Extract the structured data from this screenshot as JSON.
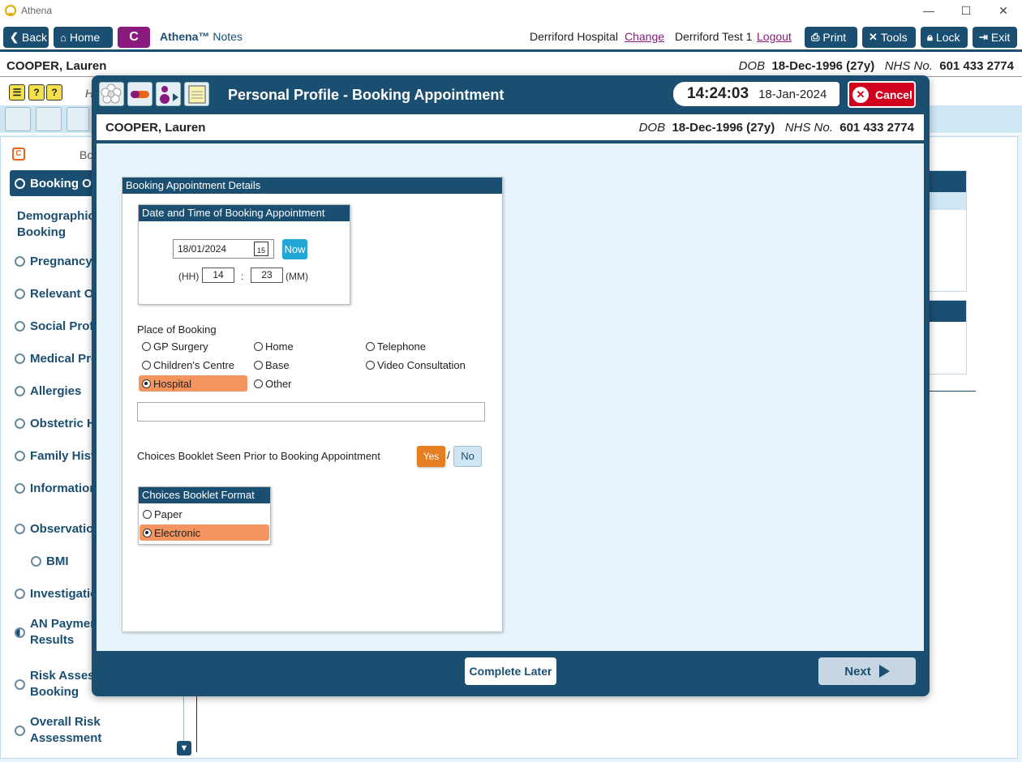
{
  "window": {
    "title": "Athena",
    "min": "—",
    "max": "☐",
    "close": "✕"
  },
  "toolbar": {
    "back": "Back",
    "home": "Home",
    "c_button": "C",
    "brand": "Athena™",
    "brand_sub": "Notes",
    "hospital": "Derriford Hospital",
    "change": "Change",
    "user": "Derriford Test 1",
    "logout": "Logout",
    "print": "Print",
    "tools": "Tools",
    "lock": "Lock",
    "exit": "Exit"
  },
  "patient": {
    "name": "COOPER, Lauren",
    "dob_label": "DOB",
    "dob": "18-Dec-1996 (27y)",
    "nhs_label": "NHS No.",
    "nhs": "601 433 2774"
  },
  "bg": {
    "h_label": "H",
    "section_prefix": "Bo"
  },
  "sidebar": {
    "items": [
      {
        "label": "Booking Ov",
        "state": "active"
      },
      {
        "label": "Demographics",
        "label2": "Booking"
      },
      {
        "label": "Pregnancy I"
      },
      {
        "label": "Relevant Ot"
      },
      {
        "label": "Social Profil"
      },
      {
        "label": "Medical Pro"
      },
      {
        "label": "Allergies"
      },
      {
        "label": "Obstetric H"
      },
      {
        "label": "Family Histo"
      },
      {
        "label": "Information"
      },
      {
        "label": "Observation"
      },
      {
        "label": "BMI"
      },
      {
        "label": "Investigatio"
      },
      {
        "label": "AN Paymen",
        "label2": "Results",
        "state": "half"
      },
      {
        "label": "Risk Assess",
        "label2": "Booking"
      },
      {
        "label": "Overall Risk",
        "label2": "Assessment"
      }
    ]
  },
  "modal": {
    "title": "Personal Profile - Booking Appointment",
    "time": "14:24:03",
    "date": "18-Jan-2024",
    "cancel": "Cancel",
    "card_title": "Booking Appointment Details",
    "datetime_title": "Date and Time of Booking Appointment",
    "date_value": "18/01/2024",
    "cal_day": "15",
    "now": "Now",
    "hh_label": "(HH)",
    "hh": "14",
    "colon": ":",
    "mm": "23",
    "mm_label": "(MM)",
    "place_label": "Place of Booking",
    "places": [
      "GP Surgery",
      "Home",
      "Telephone",
      "Children's Centre",
      "Base",
      "Video Consultation",
      "Hospital",
      "Other"
    ],
    "place_selected": "Hospital",
    "other_text": "",
    "choices_label": "Choices Booklet Seen Prior to Booking Appointment",
    "yes": "Yes",
    "slash": "/",
    "no": "No",
    "choices_selected": "Yes",
    "format_title": "Choices Booklet Format",
    "formats": [
      "Paper",
      "Electronic"
    ],
    "format_selected": "Electronic",
    "complete_later": "Complete Later",
    "next": "Next"
  }
}
